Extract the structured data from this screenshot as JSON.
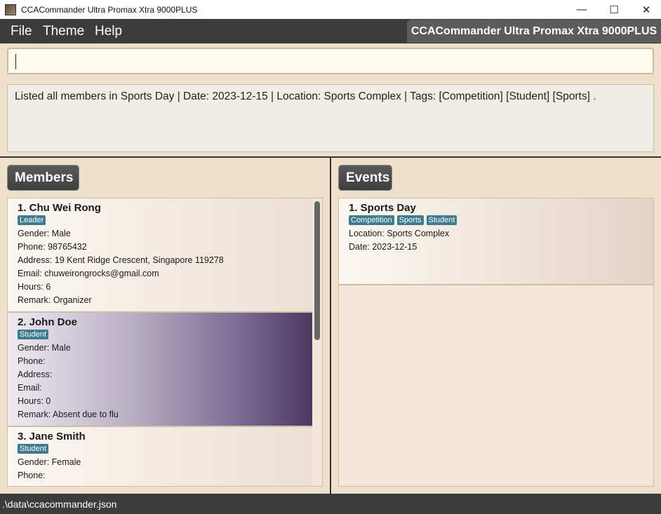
{
  "window": {
    "title": "CCACommander Ultra Promax Xtra 9000PLUS",
    "minimize": "—",
    "maximize": "☐",
    "close": "✕"
  },
  "menu": {
    "file": "File",
    "theme": "Theme",
    "help": "Help",
    "app_name": "CCACommander Ultra Promax Xtra 9000PLUS"
  },
  "command_box": {
    "value": ""
  },
  "result": {
    "text": "Listed all members in Sports Day | Date: 2023-12-15 | Location: Sports Complex | Tags: [Competition] [Student] [Sports] ."
  },
  "members_panel": {
    "title": "Members",
    "items": [
      {
        "title": "1.  Chu Wei Rong",
        "tags": [
          "Leader"
        ],
        "gender": "Gender: Male",
        "phone": "Phone: 98765432",
        "address": "Address: 19 Kent Ridge Crescent, Singapore 119278",
        "email": "Email: chuweirongrocks@gmail.com",
        "hours": "Hours: 6",
        "remark": "Remark: Organizer"
      },
      {
        "title": "2.  John Doe",
        "tags": [
          "Student"
        ],
        "gender": "Gender: Male",
        "phone": "Phone:",
        "address": "Address:",
        "email": "Email:",
        "hours": "Hours: 0",
        "remark": "Remark: Absent due to flu"
      },
      {
        "title": "3.  Jane Smith",
        "tags": [
          "Student"
        ],
        "gender": "Gender: Female",
        "phone": "Phone:"
      }
    ]
  },
  "events_panel": {
    "title": "Events",
    "items": [
      {
        "title": "1.  Sports Day",
        "tags": [
          "Competition",
          "Sports",
          "Student"
        ],
        "location": "Location: Sports Complex",
        "date": "Date: 2023-12-15"
      }
    ]
  },
  "status": {
    "path": ".\\data\\ccacommander.json"
  },
  "colors": {
    "background": "#efe0cc",
    "menubar": "#3c3c3c",
    "tag": "#3e7b91",
    "selected_card_accent": "#4a3a62"
  }
}
